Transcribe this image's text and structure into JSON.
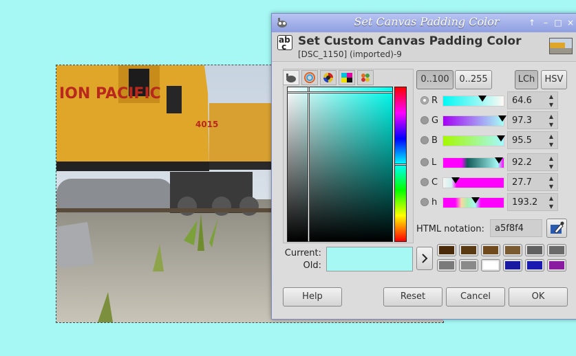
{
  "window": {
    "title": "Set Canvas Padding Color",
    "win_buttons": [
      "↑",
      "–",
      "□",
      "×"
    ]
  },
  "header": {
    "title": "Set Custom Canvas Padding Color",
    "subtitle": "[DSC_1150] (imported)-9"
  },
  "selector_tabs": [
    "gimp-icon",
    "watercolor-icon",
    "color-wheel-icon",
    "cmyk-icon",
    "palette-icon"
  ],
  "color_square": {
    "hue_marker_fraction": 0.5,
    "cursor_x_fraction": 0.2,
    "cursor_y_fraction": 0.03
  },
  "range_buttons": {
    "r100": "0..100",
    "r255": "0..255"
  },
  "model_buttons": {
    "lch": "LCh",
    "hsv": "HSV"
  },
  "channels": [
    {
      "label": "R",
      "value": "64.6",
      "fraction": 0.646,
      "selected": true
    },
    {
      "label": "G",
      "value": "97.3",
      "fraction": 0.973,
      "selected": false
    },
    {
      "label": "B",
      "value": "95.5",
      "fraction": 0.955,
      "selected": false
    },
    {
      "label": "L",
      "value": "92.2",
      "fraction": 0.922,
      "selected": false
    },
    {
      "label": "C",
      "value": "27.7",
      "fraction": 0.2,
      "selected": false
    },
    {
      "label": "h",
      "value": "193.2",
      "fraction": 0.537,
      "selected": false
    }
  ],
  "html_notation": {
    "label": "HTML notation:",
    "value": "a5f8f4"
  },
  "current_label": "Current:",
  "old_label": "Old:",
  "current_color": "#a5f8f4",
  "old_color": "#a5f8f4",
  "history_colors": [
    "#4a2a0a",
    "#5a3a12",
    "#6e4a1c",
    "#7a5a30",
    "#606060",
    "#6a6a6a",
    "#7a7a7a",
    "#8a8a8a",
    "#ffffff",
    "#1a1aa0",
    "#1a1ab0",
    "#8a1aa0"
  ],
  "buttons": {
    "help": "Help",
    "reset": "Reset",
    "cancel": "Cancel",
    "ok": "OK"
  },
  "image_text": {
    "railroad": "ION PACIFIC",
    "unit": "4015"
  },
  "colors": {
    "accent_title": "#8f9fe0",
    "canvas_padding": "#a5f8f4"
  }
}
